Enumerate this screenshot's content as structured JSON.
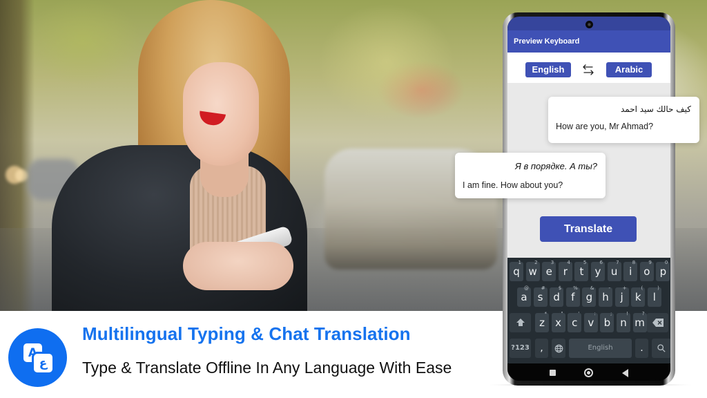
{
  "hero": {
    "image_description": "Woman with long blonde hair in black leather jacket smiling at smartphone on a blurred city street"
  },
  "banner": {
    "icon": "translate-icon",
    "icon_glyph_a": "A",
    "icon_glyph_b": "ع",
    "title": "Multilingual Typing & Chat Translation",
    "subtitle": "Type & Translate Offline In Any Language With Ease",
    "accent_color": "#1673ee"
  },
  "phone": {
    "app_bar_title": "Preview Keyboard",
    "source_language": "English",
    "target_language": "Arabic",
    "swap_icon": "swap-arrows-icon",
    "translate_label": "Translate",
    "primary_color": "#3f51b5",
    "chat": [
      {
        "original": "كيف حالك سيد احمد",
        "translation": "How are you, Mr Ahmad?"
      },
      {
        "original": "Я в порядке. А ты?",
        "translation": "I am fine. How about you?"
      }
    ],
    "keyboard": {
      "row1": [
        {
          "k": "q",
          "h": "1"
        },
        {
          "k": "w",
          "h": "2"
        },
        {
          "k": "e",
          "h": "3"
        },
        {
          "k": "r",
          "h": "4"
        },
        {
          "k": "t",
          "h": "5"
        },
        {
          "k": "y",
          "h": "6"
        },
        {
          "k": "u",
          "h": "7"
        },
        {
          "k": "i",
          "h": "8"
        },
        {
          "k": "o",
          "h": "9"
        },
        {
          "k": "p",
          "h": "0"
        }
      ],
      "row2": [
        {
          "k": "a",
          "h": "@"
        },
        {
          "k": "s",
          "h": "#"
        },
        {
          "k": "d",
          "h": "$"
        },
        {
          "k": "f",
          "h": "%"
        },
        {
          "k": "g",
          "h": "&"
        },
        {
          "k": "h",
          "h": "-"
        },
        {
          "k": "j",
          "h": "+"
        },
        {
          "k": "k",
          "h": "("
        },
        {
          "k": "l",
          "h": ")"
        }
      ],
      "row3": [
        {
          "k": "z",
          "h": "*"
        },
        {
          "k": "x",
          "h": "\""
        },
        {
          "k": "c",
          "h": "'"
        },
        {
          "k": "v",
          "h": ":"
        },
        {
          "k": "b",
          "h": ";"
        },
        {
          "k": "n",
          "h": "!"
        },
        {
          "k": "m",
          "h": "?"
        }
      ],
      "shift_icon": "shift-icon",
      "backspace_icon": "backspace-icon",
      "symbols_label": "?123",
      "comma_label": ",",
      "globe_icon": "globe-icon",
      "space_label": "English",
      "period_label": ".",
      "search_icon": "search-icon"
    },
    "nav": {
      "recents_icon": "recents-icon",
      "home_icon": "home-icon",
      "back_icon": "back-icon"
    }
  }
}
